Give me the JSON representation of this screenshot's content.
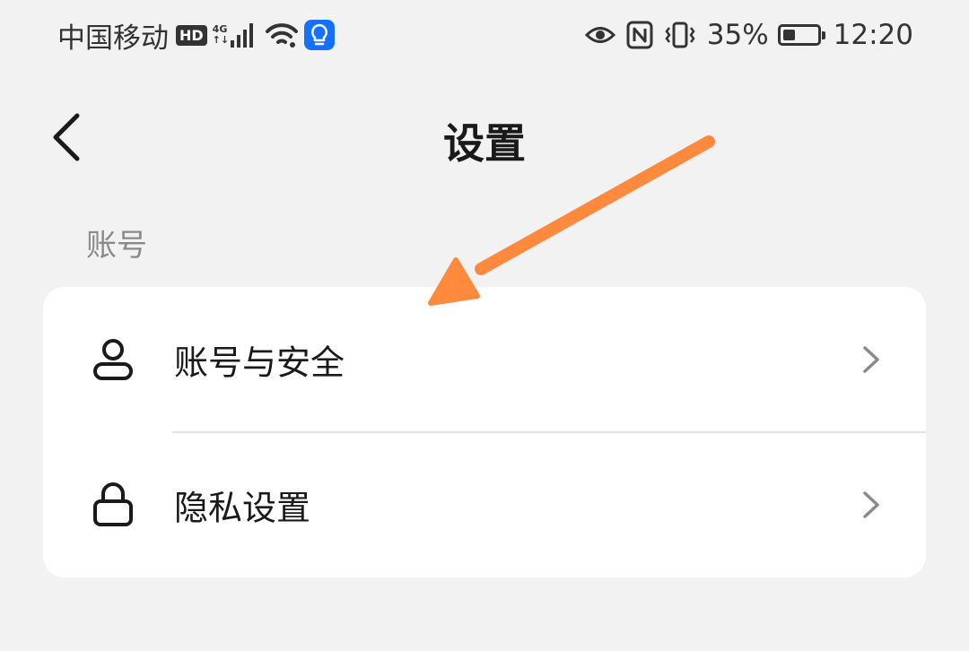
{
  "status_bar": {
    "carrier": "中国移动",
    "hd": "HD",
    "network": "4G",
    "network_sub": "↑↓",
    "battery_percent": "35%",
    "battery_level": 0.35,
    "time": "12:20"
  },
  "header": {
    "title": "设置"
  },
  "section": {
    "label": "账号",
    "items": [
      {
        "label": "账号与安全",
        "icon": "person-icon"
      },
      {
        "label": "隐私设置",
        "icon": "lock-icon"
      }
    ]
  },
  "colors": {
    "background": "#f2f2f2",
    "card": "#ffffff",
    "annotation_arrow": "#ff8a3d",
    "status_accent": "#1670ff"
  }
}
